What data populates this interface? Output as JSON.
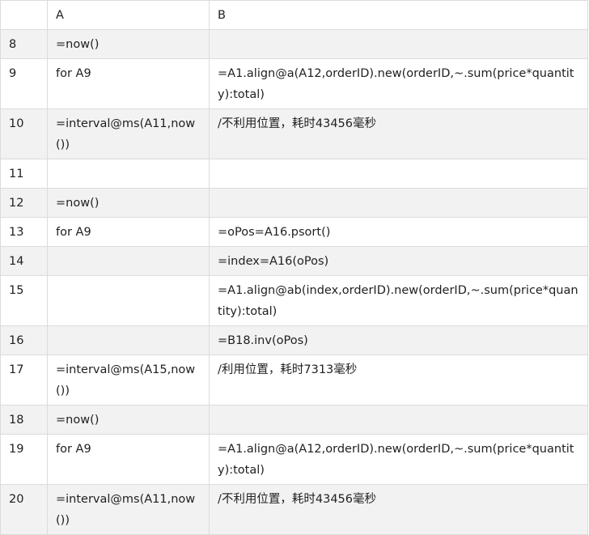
{
  "header": {
    "corner": "",
    "col_a": "A",
    "col_b": "B"
  },
  "rows": [
    {
      "num": "8",
      "a": "=now()",
      "b": ""
    },
    {
      "num": "9",
      "a": "for A9",
      "b": "=A1.align@a(A12,orderID).new(orderID,~.sum(price*quantity):total)"
    },
    {
      "num": "10",
      "a": "=interval@ms(A11,now())",
      "b": "/不利用位置，耗时43456毫秒"
    },
    {
      "num": "11",
      "a": "",
      "b": ""
    },
    {
      "num": "12",
      "a": "=now()",
      "b": ""
    },
    {
      "num": "13",
      "a": "for A9",
      "b": "=oPos=A16.psort()"
    },
    {
      "num": "14",
      "a": "",
      "b": "=index=A16(oPos)"
    },
    {
      "num": "15",
      "a": "",
      "b": "=A1.align@ab(index,orderID).new(orderID,~.sum(price*quantity):total)"
    },
    {
      "num": "16",
      "a": "",
      "b": "=B18.inv(oPos)"
    },
    {
      "num": "17",
      "a": "=interval@ms(A15,now())",
      "b": "/利用位置，耗时7313毫秒"
    },
    {
      "num": "18",
      "a": "=now()",
      "b": ""
    },
    {
      "num": "19",
      "a": "for A9",
      "b": "=A1.align@a(A12,orderID).new(orderID,~.sum(price*quantity):total)"
    },
    {
      "num": "20",
      "a": "=interval@ms(A11,now())",
      "b": "/不利用位置，耗时43456毫秒"
    }
  ]
}
